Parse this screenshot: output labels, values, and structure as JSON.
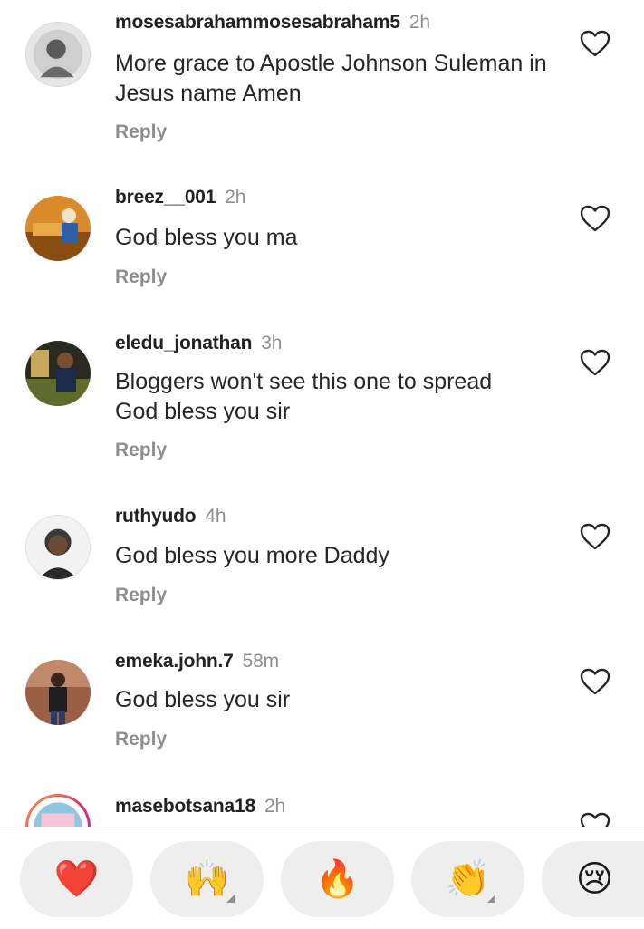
{
  "comments": [
    {
      "username": "mosesabrahammosesabraham5",
      "time": "2h",
      "text": "More grace to Apostle Johnson Suleman in Jesus name Amen",
      "reply_label": "Reply",
      "avatar_icon": "user-avatar"
    },
    {
      "username": "breez__001",
      "time": "2h",
      "text": "God bless you ma",
      "reply_label": "Reply",
      "avatar_icon": "user-avatar"
    },
    {
      "username": "eledu_jonathan",
      "time": "3h",
      "text": "Bloggers won't see this one to spread God bless you sir",
      "reply_label": "Reply",
      "avatar_icon": "user-avatar"
    },
    {
      "username": "ruthyudo",
      "time": "4h",
      "text": "God bless you more Daddy",
      "reply_label": "Reply",
      "avatar_icon": "user-avatar"
    },
    {
      "username": "emeka.john.7",
      "time": "58m",
      "text": "God bless you sir",
      "reply_label": "Reply",
      "avatar_icon": "user-avatar"
    },
    {
      "username": "masebotsana18",
      "time": "2h",
      "text": "",
      "reply_label": "",
      "avatar_icon": "user-avatar"
    }
  ],
  "reactions": [
    {
      "emoji": "❤️",
      "name": "red-heart"
    },
    {
      "emoji": "🙌",
      "name": "raising-hands"
    },
    {
      "emoji": "🔥",
      "name": "fire"
    },
    {
      "emoji": "👏",
      "name": "clapping-hands"
    },
    {
      "emoji": "😢",
      "name": "crying-face"
    }
  ],
  "colors": {
    "username": "#222222",
    "secondary": "#8e8e8e",
    "reaction_bg": "#eeeeee",
    "heart_outline": "#262626"
  }
}
